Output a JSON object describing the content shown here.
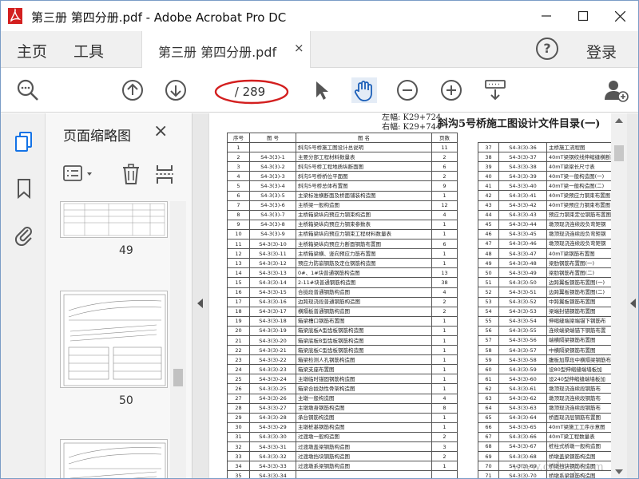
{
  "window": {
    "title": "第三册 第四分册.pdf - Adobe Acrobat Pro DC",
    "accent_red": "#d31f1f"
  },
  "menubar": {
    "home": "主页",
    "tools": "工具",
    "tab_label": "第三册 第四分册.pdf",
    "tab_close": "×",
    "help": "?",
    "login": "登录"
  },
  "toolbar": {
    "page_current": "",
    "page_total": "/ 289"
  },
  "thumbnails": {
    "title": "页面缩略图",
    "close": "×",
    "pages": [
      {
        "num": "49"
      },
      {
        "num": "50"
      }
    ]
  },
  "document": {
    "left_label_1": "左幅: K29+724",
    "left_label_2": "右幅: K29+744",
    "title": "斜沟5号桥施工图设计文件目录(一)",
    "left_headers": [
      "序号",
      "图 号",
      "图 名",
      "页数"
    ],
    "left_rows": [
      [
        "1",
        "",
        "斜沟5号桥施工图设计总说明",
        "11"
      ],
      [
        "2",
        "S4-3(3)-1",
        "主要分部工程材料数量表",
        "2"
      ],
      [
        "3",
        "S4-3(3)-2",
        "斜沟5号桥工程地质纵断面图",
        "6"
      ],
      [
        "4",
        "S4-3(3)-3",
        "斜沟5号桥桥位平面图",
        "2"
      ],
      [
        "5",
        "S4-3(3)-4",
        "斜沟5号桥总体布置图",
        "9"
      ],
      [
        "6",
        "S4-3(3)-5",
        "主梁标准横断面及桥面铺装构造图",
        "1"
      ],
      [
        "7",
        "S4-3(3)-6",
        "主桥梁一般构造图",
        "12"
      ],
      [
        "8",
        "S4-3(3)-7",
        "主桥箱梁纵向预应力钢束构造图",
        "4"
      ],
      [
        "9",
        "S4-3(3)-8",
        "主桥箱梁纵向预应力钢束参数表",
        "1"
      ],
      [
        "10",
        "S4-3(3)-9",
        "主桥箱梁纵向预应力钢束工程材料数量表",
        "1"
      ],
      [
        "11",
        "S4-3(3)-10",
        "主桥箱梁纵向预应力断面钢筋布置图",
        "6"
      ],
      [
        "12",
        "S4-3(3)-11",
        "主桥箱梁横、竖向预应力筋布置图",
        "1"
      ],
      [
        "13",
        "S4-3(3)-12",
        "预应力防崩钢筋及定位钢筋构造图",
        "1"
      ],
      [
        "14",
        "S4-3(3)-13",
        "0#、1#块普通钢筋构造图",
        "13"
      ],
      [
        "15",
        "S4-3(3)-14",
        "2-11#块普通钢筋构造图",
        "38"
      ],
      [
        "16",
        "S4-3(3)-15",
        "合拢段普通钢筋构造图",
        "4"
      ],
      [
        "17",
        "S4-3(3)-16",
        "边跨现浇段普通钢筋构造图",
        "2"
      ],
      [
        "18",
        "S4-3(3)-17",
        "横隔板普通钢筋构造图",
        "2"
      ],
      [
        "19",
        "S4-3(3)-18",
        "箱梁槽口钢筋布置图",
        "1"
      ],
      [
        "20",
        "S4-3(3)-19",
        "箱梁底板A型齿板钢筋构造图",
        "1"
      ],
      [
        "21",
        "S4-3(3)-20",
        "箱梁底板B型齿板钢筋构造图",
        "1"
      ],
      [
        "22",
        "S4-3(3)-21",
        "箱梁底板C型齿板钢筋构造图",
        "1"
      ],
      [
        "23",
        "S4-3(3)-22",
        "箱梁检测人孔钢筋构造图",
        "1"
      ],
      [
        "24",
        "S4-3(3)-23",
        "箱梁支座布置图",
        "1"
      ],
      [
        "25",
        "S4-3(3)-24",
        "主墩临时锚固钢筋构造图",
        "1"
      ],
      [
        "26",
        "S4-3(3)-25",
        "箱梁合拢劲性骨架构造图",
        "1"
      ],
      [
        "27",
        "S4-3(3)-26",
        "主墩一般构造图",
        "4"
      ],
      [
        "28",
        "S4-3(3)-27",
        "主墩墩身钢筋构造图",
        "8"
      ],
      [
        "29",
        "S4-3(3)-28",
        "承台钢筋构造图",
        "1"
      ],
      [
        "30",
        "S4-3(3)-29",
        "主墩桩基钢筋构造图",
        "1"
      ],
      [
        "31",
        "S4-3(3)-30",
        "过渡墩一般构造图",
        "2"
      ],
      [
        "32",
        "S4-3(3)-31",
        "过渡墩盖梁钢筋构造图",
        "3"
      ],
      [
        "33",
        "S4-3(3)-32",
        "过渡墩挡块钢筋构造图",
        "2"
      ],
      [
        "34",
        "S4-3(3)-33",
        "过渡墩系梁钢筋构造图",
        "1"
      ],
      [
        "35",
        "S4-3(3)-34",
        "",
        ""
      ]
    ],
    "right_rows": [
      [
        "37",
        "S4-3(3)-36",
        "主桥施工流程图"
      ],
      [
        "38",
        "S4-3(3)-37",
        "40mT梁钢绞线伸缩缝横断面及"
      ],
      [
        "39",
        "S4-3(3)-38",
        "40mT梁梁长尺寸表"
      ],
      [
        "40",
        "S4-3(3)-39",
        "40mT梁一般构造图(一)"
      ],
      [
        "41",
        "S4-3(3)-40",
        "40mT梁一般构造图(二)"
      ],
      [
        "42",
        "S4-3(3)-41",
        "40mT梁预应力钢束布置图"
      ],
      [
        "43",
        "S4-3(3)-42",
        "40mT梁预应力钢束布置图"
      ],
      [
        "44",
        "S4-3(3)-43",
        "预应力钢束定位钢筋布置图"
      ],
      [
        "45",
        "S4-3(3)-44",
        "墩顶现浇连续段负弯矩钢"
      ],
      [
        "46",
        "S4-3(3)-45",
        "墩顶现浇连续段负弯矩钢"
      ],
      [
        "47",
        "S4-3(3)-46",
        "墩顶现浇连续段负弯矩钢"
      ],
      [
        "48",
        "S4-3(3)-47",
        "40mT梁钢筋布置图"
      ],
      [
        "49",
        "S4-3(3)-48",
        "梁肋钢筋布置图(一)"
      ],
      [
        "50",
        "S4-3(3)-49",
        "梁肋钢筋布置图(二)"
      ],
      [
        "51",
        "S4-3(3)-50",
        "边跨翼板钢筋布置图(一)"
      ],
      [
        "52",
        "S4-3(3)-51",
        "边跨翼板钢筋布置图(二)"
      ],
      [
        "53",
        "S4-3(3)-52",
        "中跨翼板钢筋布置图"
      ],
      [
        "54",
        "S4-3(3)-53",
        "梁端封锚钢筋布置图"
      ],
      [
        "55",
        "S4-3(3)-54",
        "伸缩缝端梁端锚下钢筋布"
      ],
      [
        "56",
        "S4-3(3)-55",
        "连续端梁端锚下钢筋布置"
      ],
      [
        "57",
        "S4-3(3)-56",
        "端横隔梁钢筋布置图"
      ],
      [
        "58",
        "S4-3(3)-57",
        "中横隔梁钢筋布置图"
      ],
      [
        "59",
        "S4-3(3)-58",
        "腹板加厚段中横隔梁钢筋布"
      ],
      [
        "60",
        "S4-3(3)-59",
        "设80型伸缩缝端墙板加"
      ],
      [
        "61",
        "S4-3(3)-60",
        "设240型伸缩缝端墙板加"
      ],
      [
        "62",
        "S4-3(3)-61",
        "墩顶现浇连续段钢筋布"
      ],
      [
        "63",
        "S4-3(3)-62",
        "墩顶现浇连续段钢筋布"
      ],
      [
        "64",
        "S4-3(3)-63",
        "墩顶现浇连续段钢筋布"
      ],
      [
        "65",
        "S4-3(3)-64",
        "桥面现浇层钢筋布置图"
      ],
      [
        "66",
        "S4-3(3)-65",
        "40mT梁施工工序示意图"
      ],
      [
        "67",
        "S4-3(3)-66",
        "40mT梁工程数量表"
      ],
      [
        "68",
        "S4-3(3)-67",
        "桩柱式桥墩一般构造图"
      ],
      [
        "69",
        "S4-3(3)-68",
        "桥墩盖梁钢筋构造图"
      ],
      [
        "70",
        "S4-3(3)-69",
        "桥墩挡块钢筋构造图"
      ],
      [
        "71",
        "S4-3(3)-70",
        "桥墩系梁钢筋构造图"
      ]
    ],
    "watermark": "www.cnbzq.com"
  }
}
